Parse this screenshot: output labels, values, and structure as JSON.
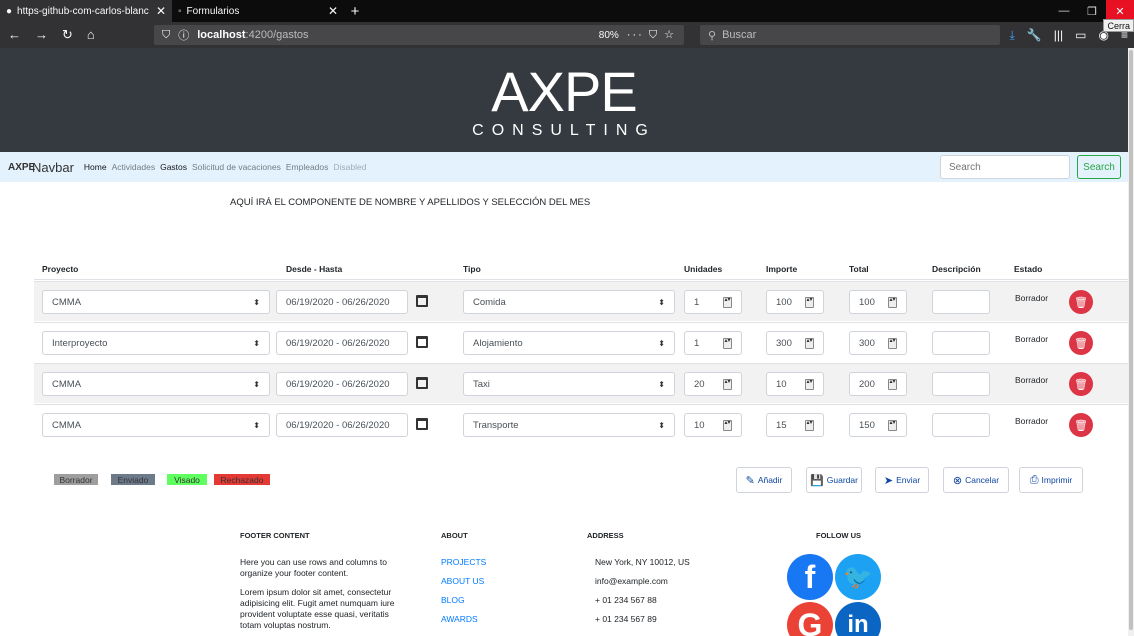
{
  "browser": {
    "tabs": [
      {
        "title": "https-github-com-carlos-blanc",
        "close": "✕"
      },
      {
        "title": "Formularios",
        "close": "✕"
      }
    ],
    "new_tab": "+",
    "url_host": "localhost",
    "url_path": ":4200/gastos",
    "zoom": "80%",
    "page_actions": "··· ⛉ ☆",
    "search_placeholder": "Buscar",
    "close_tooltip": "Cerra"
  },
  "header": {
    "logo_main": "AXPE",
    "logo_sub": "CONSULTING"
  },
  "sitenav": {
    "mini_logo": "AXPE",
    "brand": "Navbar",
    "links": [
      "Home",
      "Actividades",
      "Gastos",
      "Solicitud de vacaciones",
      "Empleados",
      "Disabled"
    ],
    "search_placeholder": "Search",
    "search_button": "Search"
  },
  "placeholder_text": "AQUÍ IRÁ EL COMPONENTE DE NOMBRE Y APELLIDOS Y SELECCIÓN DEL MES",
  "table": {
    "headers": [
      "Proyecto",
      "Desde - Hasta",
      "Tipo",
      "Unidades",
      "Importe",
      "Total",
      "Descripción",
      "Estado"
    ],
    "rows": [
      {
        "proyecto": "CMMA",
        "fechas": "06/19/2020 - 06/26/2020",
        "tipo": "Comida",
        "unidades": "1",
        "importe": "100",
        "total": "100",
        "descripcion": "",
        "estado": "Borrador"
      },
      {
        "proyecto": "Interproyecto",
        "fechas": "06/19/2020 - 06/26/2020",
        "tipo": "Alojamiento",
        "unidades": "1",
        "importe": "300",
        "total": "300",
        "descripcion": "",
        "estado": "Borrador"
      },
      {
        "proyecto": "CMMA",
        "fechas": "06/19/2020 - 06/26/2020",
        "tipo": "Taxi",
        "unidades": "20",
        "importe": "10",
        "total": "200",
        "descripcion": "",
        "estado": "Borrador"
      },
      {
        "proyecto": "CMMA",
        "fechas": "06/19/2020 - 06/26/2020",
        "tipo": "Transporte",
        "unidades": "10",
        "importe": "15",
        "total": "150",
        "descripcion": "",
        "estado": "Borrador"
      }
    ]
  },
  "legend": [
    {
      "label": "Borrador",
      "color": "#9e9e9e"
    },
    {
      "label": "Enviado",
      "color": "#6c7a8a"
    },
    {
      "label": "Visado",
      "color": "#5eff5e"
    },
    {
      "label": "Rechazado",
      "color": "#e53935"
    }
  ],
  "actions": {
    "anadir": "Añadir",
    "guardar": "Guardar",
    "enviar": "Enviar",
    "cancelar": "Cancelar",
    "imprimir": "Imprimir"
  },
  "footer": {
    "content_title": "FOOTER CONTENT",
    "content_p1": "Here you can use rows and columns to organize your footer content.",
    "content_p2": "Lorem ipsum dolor sit amet, consectetur adipisicing elit. Fugit amet numquam iure provident voluptate esse quasi, veritatis totam voluptas nostrum.",
    "about_title": "ABOUT",
    "about_links": [
      "PROJECTS",
      "ABOUT US",
      "BLOG",
      "AWARDS"
    ],
    "address_title": "ADDRESS",
    "address_lines": [
      "New York, NY 10012, US",
      "info@example.com",
      "+ 01 234 567 88",
      "+ 01 234 567 89"
    ],
    "follow_title": "FOLLOW US",
    "social": [
      {
        "letter": "f",
        "color": "#1877f2"
      },
      {
        "letter": "🐦",
        "color": "#1da1f2"
      },
      {
        "letter": "G",
        "color": "#ea4335"
      },
      {
        "letter": "in",
        "color": "#0a66c2"
      }
    ]
  }
}
